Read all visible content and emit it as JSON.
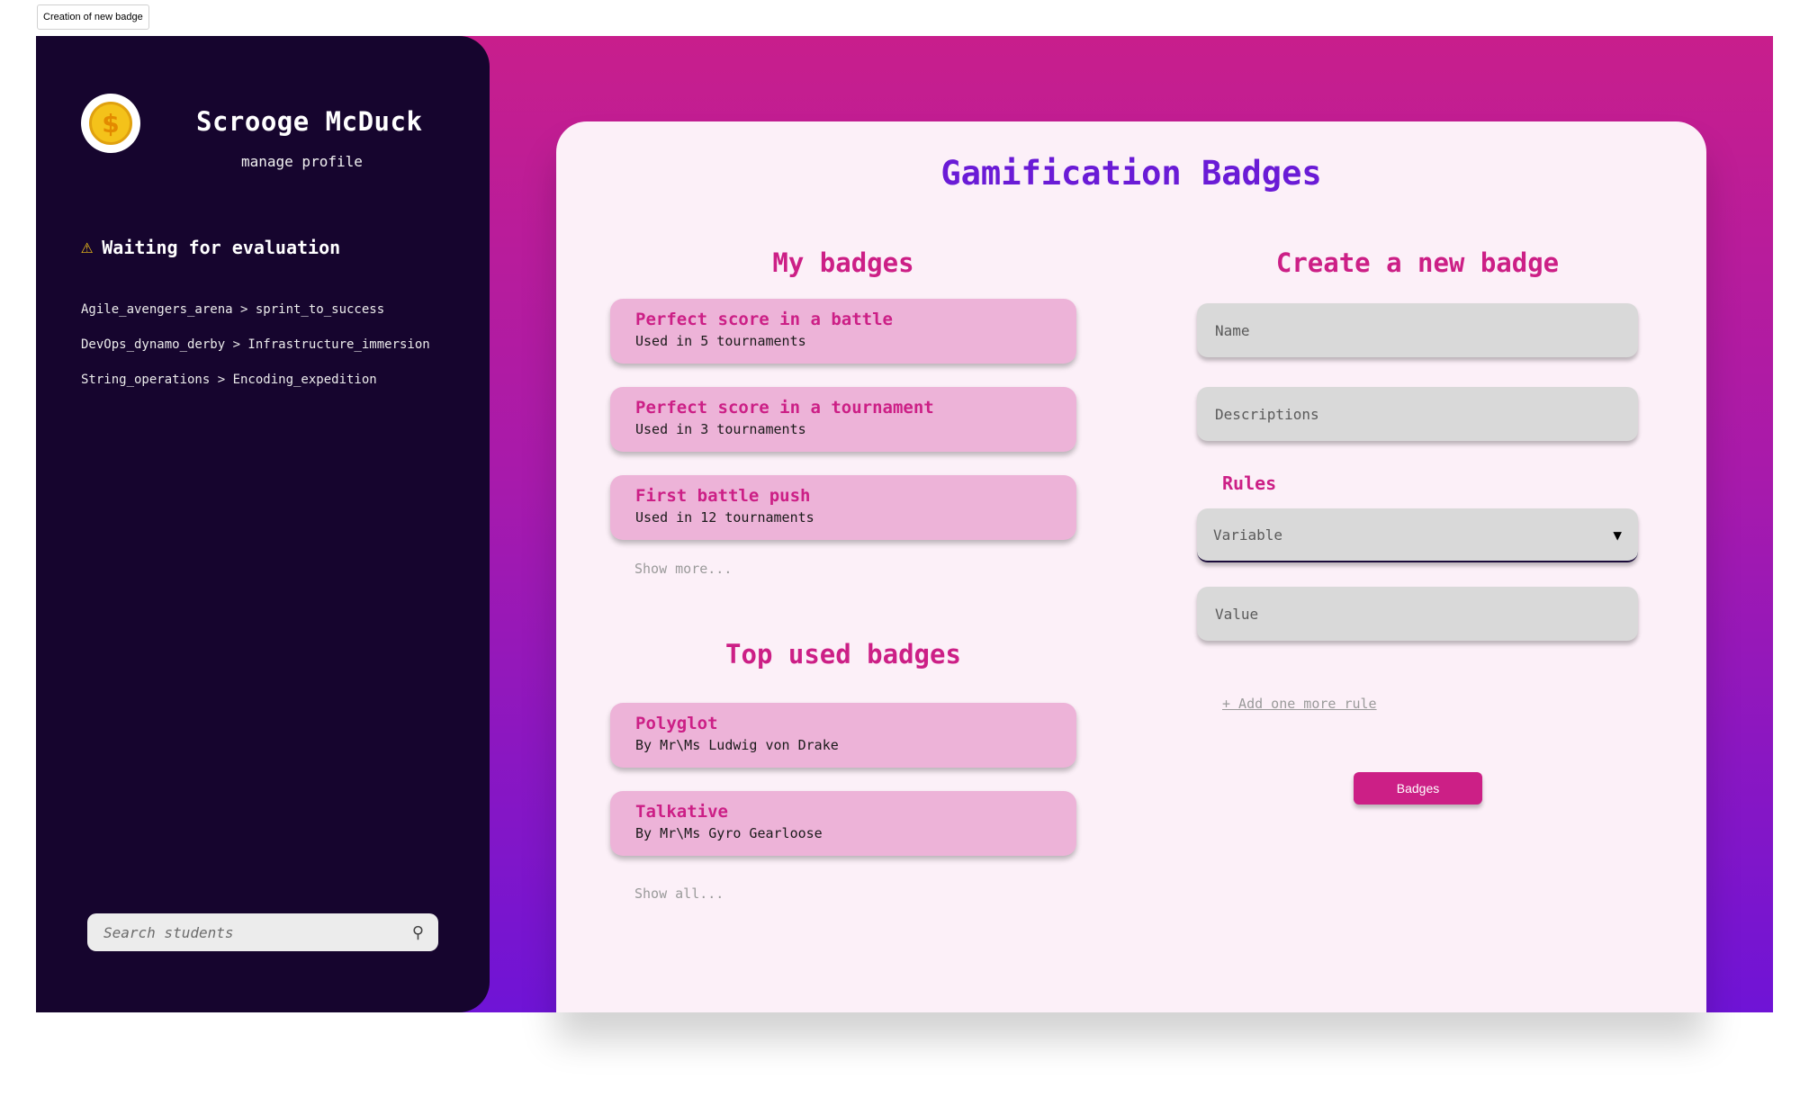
{
  "window": {
    "tab_label": "Creation of new badge"
  },
  "sidebar": {
    "user_name": "Scrooge McDuck",
    "profile_link": "manage profile",
    "waiting_title": "Waiting for evaluation",
    "evaluations": [
      "Agile_avengers_arena > sprint_to_success",
      "DevOps_dynamo_derby > Infrastructure_immersion",
      "String_operations > Encoding_expedition"
    ],
    "search_placeholder": "Search students"
  },
  "main": {
    "title": "Gamification Badges",
    "my_badges": {
      "title": "My badges",
      "items": [
        {
          "name": "Perfect score in a battle",
          "sub": "Used in 5 tournaments"
        },
        {
          "name": "Perfect score in a tournament",
          "sub": "Used in 3 tournaments"
        },
        {
          "name": "First battle push",
          "sub": "Used in 12 tournaments"
        }
      ],
      "more_label": "Show more..."
    },
    "top_badges": {
      "title": "Top used badges",
      "items": [
        {
          "name": "Polyglot",
          "sub": "By Mr\\Ms Ludwig von Drake"
        },
        {
          "name": "Talkative",
          "sub": "By Mr\\Ms Gyro Gearloose"
        }
      ],
      "more_label": "Show all..."
    },
    "create": {
      "title": "Create a new badge",
      "name_placeholder": "Name",
      "description_placeholder": "Descriptions",
      "rules_label": "Rules",
      "variable_value": "Variable",
      "value_placeholder": "Value",
      "add_rule_label": "+ Add one more rule",
      "submit_label": "Badges"
    }
  },
  "colors": {
    "sidebar_bg": "#16052e",
    "accent_pink": "#cc1f86",
    "accent_purple": "#6a1bd6",
    "badge_bg": "#edb3d8"
  }
}
